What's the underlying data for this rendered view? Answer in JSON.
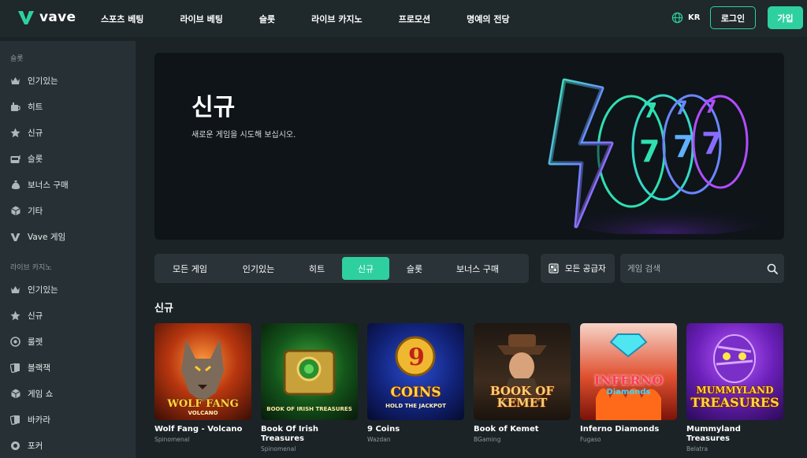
{
  "brand": {
    "name": "vave",
    "accent": "#2fd0a0"
  },
  "nav": [
    {
      "label": "스포츠 베팅"
    },
    {
      "label": "라이브 베팅"
    },
    {
      "label": "슬롯"
    },
    {
      "label": "라이브 카지노"
    },
    {
      "label": "프로모션"
    },
    {
      "label": "명예의 전당"
    }
  ],
  "header": {
    "lang": "KR",
    "login": "로그인",
    "join": "가입"
  },
  "sidebar": {
    "slots_heading": "슬롯",
    "slots": [
      {
        "label": "인기있는",
        "icon": "crown-icon"
      },
      {
        "label": "히트",
        "icon": "cup-icon"
      },
      {
        "label": "신규",
        "icon": "star-icon"
      },
      {
        "label": "슬롯",
        "icon": "slot-machine-icon"
      },
      {
        "label": "보너스 구매",
        "icon": "money-bag-icon"
      },
      {
        "label": "기타",
        "icon": "cube-icon"
      },
      {
        "label": "Vave 게임",
        "icon": "vave-icon"
      }
    ],
    "casino_heading": "라이브 카지노",
    "casino": [
      {
        "label": "인기있는",
        "icon": "crown-icon"
      },
      {
        "label": "신규",
        "icon": "star-icon"
      },
      {
        "label": "룰렛",
        "icon": "roulette-icon"
      },
      {
        "label": "블랙잭",
        "icon": "cards-icon"
      },
      {
        "label": "게임 쇼",
        "icon": "cube-icon"
      },
      {
        "label": "바카라",
        "icon": "cards-icon"
      },
      {
        "label": "포커",
        "icon": "chip-icon"
      }
    ]
  },
  "hero": {
    "title": "신규",
    "subtitle": "새로운 게임을 시도해 보십시오."
  },
  "tabs": [
    {
      "label": "모든 게임",
      "active": false
    },
    {
      "label": "인기있는",
      "active": false
    },
    {
      "label": "히트",
      "active": false
    },
    {
      "label": "신규",
      "active": true
    },
    {
      "label": "슬롯",
      "active": false
    },
    {
      "label": "보너스 구매",
      "active": false
    }
  ],
  "providers": {
    "label": "모든 공급자"
  },
  "search": {
    "placeholder": "게임 검색"
  },
  "section": {
    "title": "신규"
  },
  "games": [
    {
      "name": "Wolf Fang - Volcano",
      "provider": "Spinomenal",
      "art_title": "WOLF FANG",
      "art_sub": "VOLCANO"
    },
    {
      "name": "Book Of Irish Treasures",
      "provider": "Spinomenal",
      "art_title": "",
      "art_sub": "BOOK OF IRISH TREASURES"
    },
    {
      "name": "9 Coins",
      "provider": "Wazdan",
      "art_title": "COINS",
      "art_sub": "HOLD THE JACKPOT"
    },
    {
      "name": "Book of Kemet",
      "provider": "BGaming",
      "art_title": "BOOK OF KEMET",
      "art_sub": ""
    },
    {
      "name": "Inferno Diamonds",
      "provider": "Fugaso",
      "art_title": "INFERNO",
      "art_sub": "Diamonds"
    },
    {
      "name": "Mummyland Treasures",
      "provider": "Belatra",
      "art_title": "MUMMYLAND",
      "art_sub": "TREASURES"
    }
  ]
}
